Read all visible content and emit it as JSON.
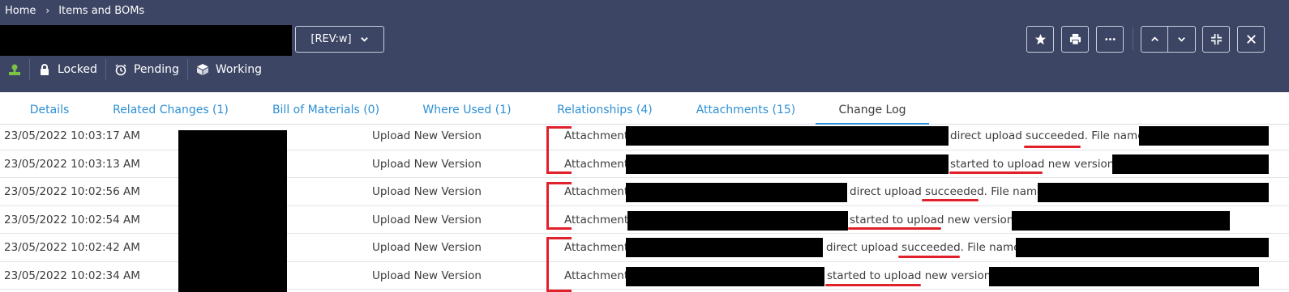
{
  "breadcrumb": {
    "home": "Home",
    "current": "Items and BOMs",
    "separator": "›"
  },
  "revision": {
    "label": "[REV:w]"
  },
  "status": {
    "items": [
      {
        "icon": "user-icon",
        "label": ""
      },
      {
        "icon": "lock-icon",
        "label": "Locked"
      },
      {
        "icon": "alarm-clock-icon",
        "label": "Pending"
      },
      {
        "icon": "cube-icon",
        "label": "Working"
      }
    ]
  },
  "toolbar": [
    "star-icon",
    "print-icon",
    "more-icon",
    "chevron-up-icon",
    "chevron-down-icon",
    "collapse-icon",
    "close-icon"
  ],
  "tabs": [
    {
      "label": "Details"
    },
    {
      "label": "Related Changes (1)"
    },
    {
      "label": "Bill of Materials (0)"
    },
    {
      "label": "Where Used (1)"
    },
    {
      "label": "Relationships (4)"
    },
    {
      "label": "Attachments (15)"
    },
    {
      "label": "Change Log",
      "active": true
    }
  ],
  "log": [
    {
      "date": "23/05/2022 10:03:17 AM",
      "action": "Upload New Version",
      "prefix": "Attachment",
      "mid": "direct upload",
      "key": "succeeded",
      "tail": ". File name:"
    },
    {
      "date": "23/05/2022 10:03:13 AM",
      "action": "Upload New Version",
      "prefix": "Attachment",
      "mid": "",
      "key": "started to upload",
      "tail": " new version:"
    },
    {
      "date": "23/05/2022 10:02:56 AM",
      "action": "Upload New Version",
      "prefix": "Attachment",
      "mid": "direct upload",
      "key": "succeeded",
      "tail": ". File name:"
    },
    {
      "date": "23/05/2022 10:02:54 AM",
      "action": "Upload New Version",
      "prefix": "Attachment",
      "mid": "",
      "key": "started to upload",
      "tail": " new version:"
    },
    {
      "date": "23/05/2022 10:02:42 AM",
      "action": "Upload New Version",
      "prefix": "Attachment",
      "mid": "direct upload",
      "key": "succeeded",
      "tail": ". File name:"
    },
    {
      "date": "23/05/2022 10:02:34 AM",
      "action": "Upload New Version",
      "prefix": "Attachment",
      "mid": "",
      "key": "started to upload",
      "tail": " new version:"
    }
  ],
  "colors": {
    "header": "#3c4564",
    "link": "#2d8fd3",
    "annotation": "#e0202a"
  }
}
